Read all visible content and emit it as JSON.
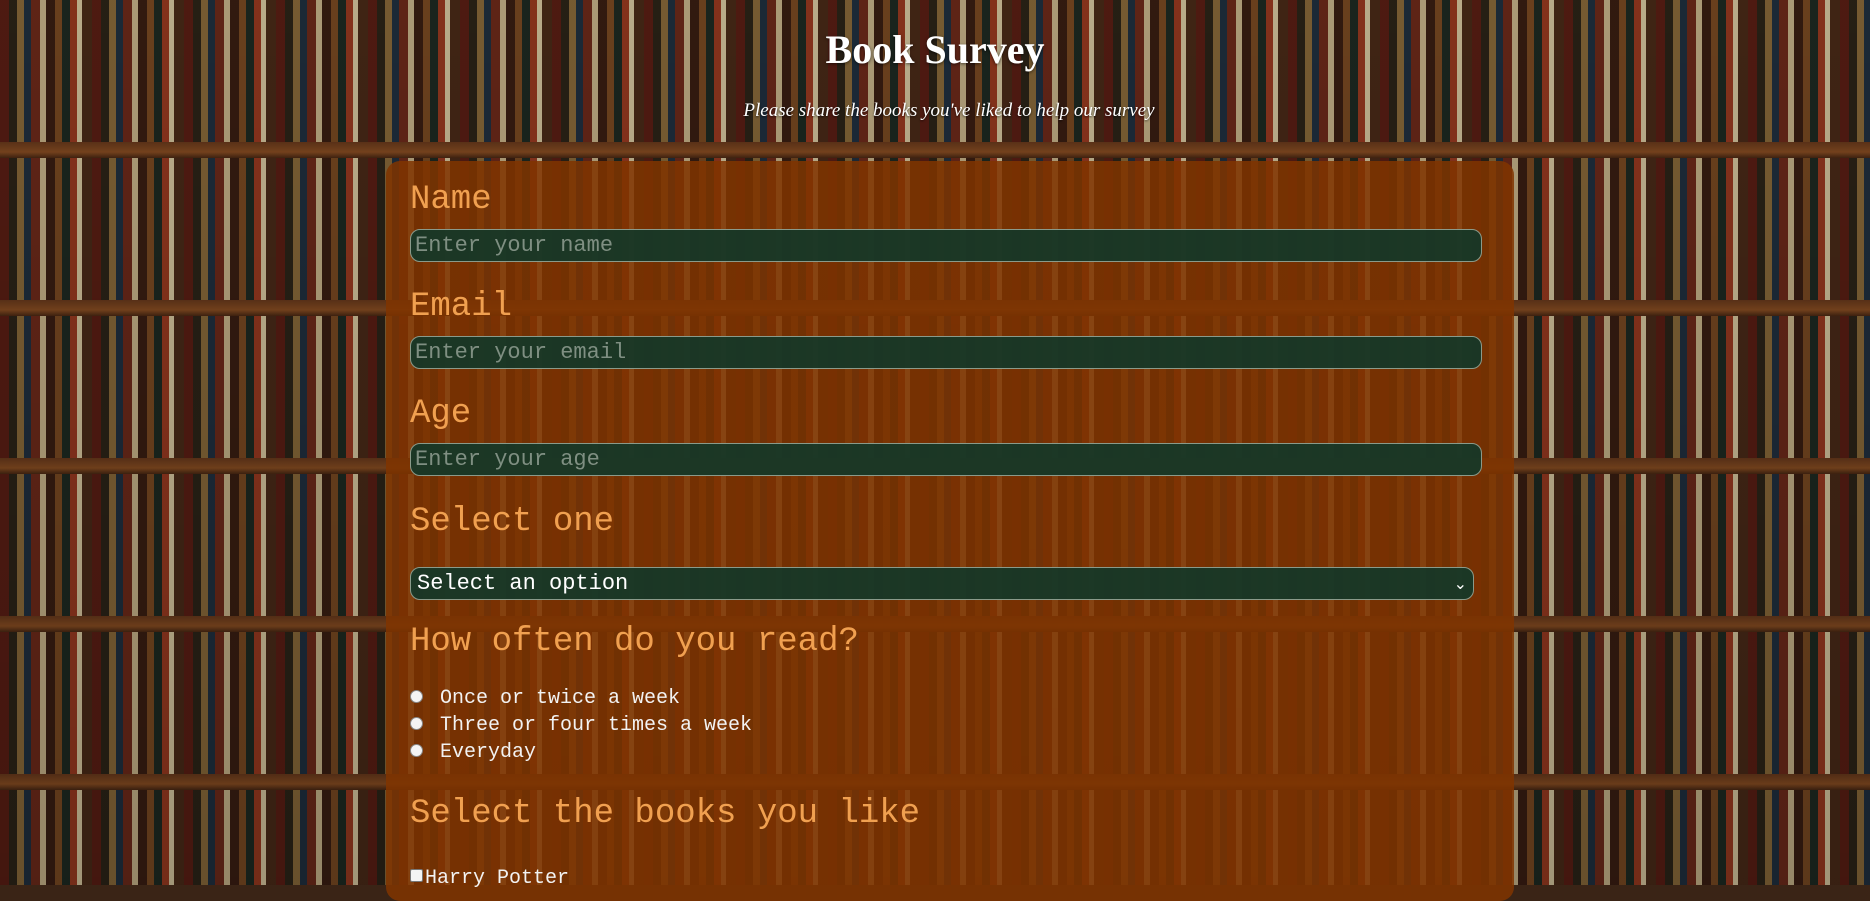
{
  "header": {
    "title": "Book Survey",
    "description": "Please share the books you've liked to help our survey"
  },
  "form": {
    "name": {
      "label": "Name",
      "placeholder": "Enter your name"
    },
    "email": {
      "label": "Email",
      "placeholder": "Enter your email"
    },
    "age": {
      "label": "Age",
      "placeholder": "Enter your age"
    },
    "dropdown": {
      "label": "Select one",
      "selected": "Select an option"
    },
    "frequency": {
      "label": "How often do you read?",
      "options": [
        "Once or twice a week",
        "Three or four times a week",
        "Everyday"
      ]
    },
    "books": {
      "label": "Select the books you like",
      "options": [
        "Harry Potter"
      ]
    }
  },
  "colors": {
    "form_background": "#803400",
    "label_color": "#f0a050",
    "input_background": "#14372a"
  }
}
